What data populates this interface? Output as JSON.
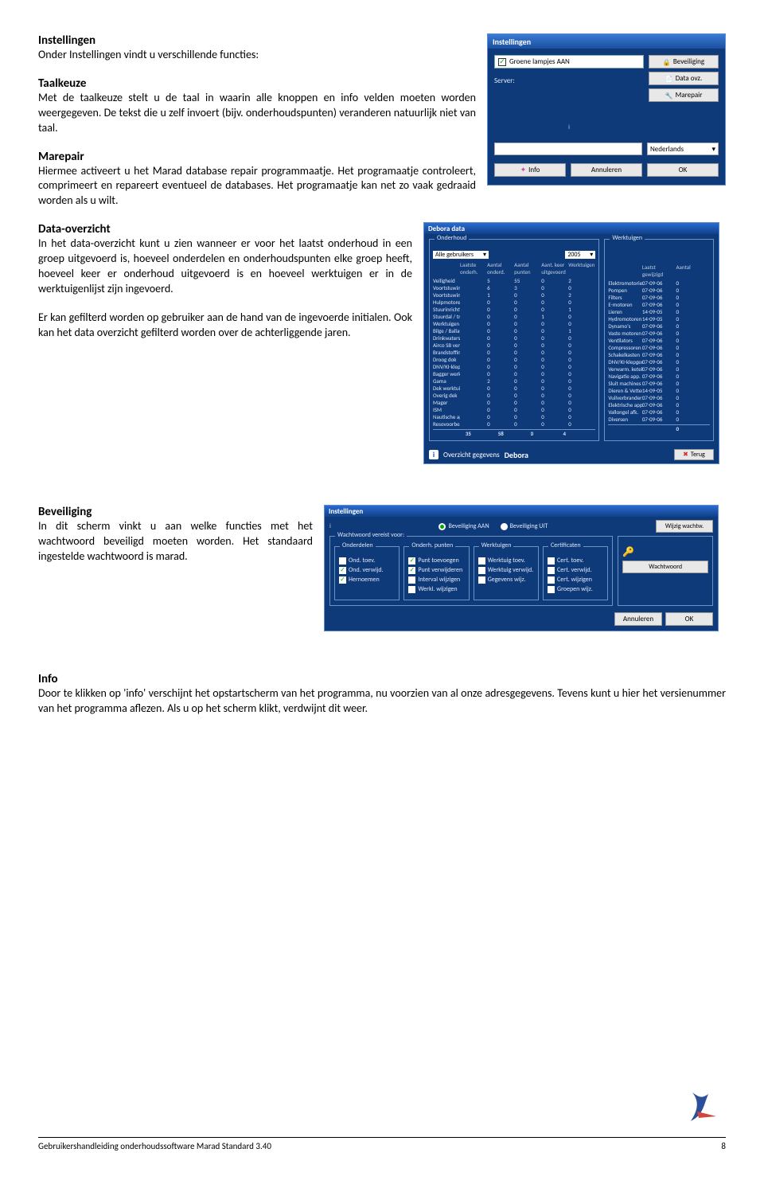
{
  "sections": {
    "instellingen_h": "Instellingen",
    "instellingen_sub": "Onder Instellingen vindt u verschillende functies:",
    "taalkeuze_h": "Taalkeuze",
    "taalkeuze_p": "Met de taalkeuze stelt u de taal in waarin alle knoppen en info velden moeten worden weergegeven. De tekst die u zelf invoert (bijv. onderhoudspunten) veranderen natuurlijk niet van taal.",
    "marepair_h": "Marepair",
    "marepair_p": "Hiermee activeert u het Marad database repair programmaatje. Het programaatje controleert, comprimeert en repareert eventueel de databases. Het programaatje kan net zo vaak gedraaid worden als u wilt.",
    "dataovz_h": "Data-overzicht",
    "dataovz_p1": "In het data-overzicht kunt u zien wanneer er voor het laatst onderhoud in een groep uitgevoerd is, hoeveel onderdelen en onderhoudspunten elke groep heeft, hoeveel keer er onderhoud uitgevoerd is en hoeveel werktuigen er in de werktuigenlijst zijn ingevoerd.",
    "dataovz_p2": "Er kan gefilterd worden op gebruiker aan de hand van de ingevoerde initialen. Ook kan het data overzicht gefilterd worden over de achterliggende jaren.",
    "beveiliging_h": "Beveiliging",
    "beveiliging_p": "In dit scherm vinkt u aan welke functies met het wachtwoord beveiligd moeten worden. Het standaard ingestelde wachtwoord is marad.",
    "info_h": "Info",
    "info_p": "Door te klikken op 'info' verschijnt het opstartscherm van het programma, nu voorzien van al onze adresgegevens. Tevens kunt u hier het versienummer van het programma aflezen. Als u op het scherm klikt, verdwijnt dit weer."
  },
  "win1": {
    "title": "Instellingen",
    "chk_green": "Groene lampjes AAN",
    "server": "Server:",
    "btn_bev": "Beveiliging",
    "btn_data": "Data ovz.",
    "btn_marepair": "Marepair",
    "lang": "Nederlands",
    "btn_info": "Info",
    "btn_cancel": "Annuleren",
    "btn_ok": "OK"
  },
  "win2": {
    "title": "Debora data",
    "grp1": "Onderhoud",
    "grp2": "Werktuigen",
    "filter_label": "Alle gebruikers",
    "year": "2005",
    "hdr1": [
      "",
      "Laatste onderh.",
      "Aantal onderd.",
      "Aantal punten",
      "Aant. keer uitgevoerd",
      "Werktuigen"
    ],
    "hdr2": [
      "",
      "Laatst gewijzigd",
      "Aantal"
    ],
    "rows1": [
      [
        "Veiligheid",
        "",
        "5",
        "55",
        "0",
        "2"
      ],
      [
        "Voortstuwing SB",
        "",
        "6",
        "3",
        "0",
        "0"
      ],
      [
        "Voortstuwing BB",
        "",
        "1",
        "0",
        "0",
        "2"
      ],
      [
        "Hulpmotoren",
        "",
        "0",
        "0",
        "0",
        "0"
      ],
      [
        "Stuurinrichting",
        "",
        "0",
        "0",
        "0",
        "1"
      ],
      [
        "Stuurdal / trim",
        "",
        "0",
        "0",
        "1",
        "0"
      ],
      [
        "Werktuigen",
        "",
        "0",
        "0",
        "0",
        "0"
      ],
      [
        "Bilge / Ballast",
        "",
        "0",
        "0",
        "0",
        "1"
      ],
      [
        "Drinkwatersyst.",
        "",
        "0",
        "0",
        "0",
        "0"
      ],
      [
        "Airco SB ventilasie",
        "",
        "0",
        "0",
        "0",
        "0"
      ],
      [
        "Brandstoffinst.",
        "",
        "0",
        "0",
        "0",
        "0"
      ],
      [
        "Droog dok",
        "",
        "0",
        "0",
        "0",
        "0"
      ],
      [
        "DNV/KI-klepgen",
        "",
        "0",
        "0",
        "0",
        "0"
      ],
      [
        "Bagger werktuigen",
        "",
        "0",
        "0",
        "0",
        "0"
      ],
      [
        "Gama",
        "",
        "2",
        "0",
        "0",
        "0"
      ],
      [
        "Dek werktuigen",
        "",
        "0",
        "0",
        "0",
        "0"
      ],
      [
        "Overig dek",
        "",
        "0",
        "0",
        "0",
        "0"
      ],
      [
        "Mager",
        "",
        "0",
        "0",
        "0",
        "0"
      ],
      [
        "ISM",
        "",
        "0",
        "0",
        "0",
        "0"
      ],
      [
        "Nautische app.",
        "",
        "0",
        "0",
        "0",
        "0"
      ],
      [
        "Resovoorbereid",
        "",
        "0",
        "0",
        "0",
        "0"
      ]
    ],
    "rows2": [
      [
        "Elektromotorieten",
        "07-09-06",
        "0"
      ],
      [
        "Pompen",
        "07-09-06",
        "0"
      ],
      [
        "Filters",
        "07-09-06",
        "0"
      ],
      [
        "E-motoren",
        "07-09-06",
        "0"
      ],
      [
        "Lieren",
        "14-09-05",
        "0"
      ],
      [
        "Hydromotoren",
        "14-09-05",
        "0"
      ],
      [
        "Dynamo's",
        "07-09-06",
        "0"
      ],
      [
        "Vaste motoren",
        "07-09-06",
        "0"
      ],
      [
        "Ventilators",
        "07-09-06",
        "0"
      ],
      [
        "Compressoren",
        "07-09-06",
        "0"
      ],
      [
        "Schakelkasten",
        "07-09-06",
        "0"
      ],
      [
        "DNV/KI-klepgen",
        "07-09-06",
        "0"
      ],
      [
        "Verwarm. ketels",
        "07-09-06",
        "0"
      ],
      [
        "Navigatie app.",
        "07-09-06",
        "0"
      ],
      [
        "Sluit machines",
        "07-09-06",
        "0"
      ],
      [
        "Dieren & Vetten",
        "14-09-05",
        "0"
      ],
      [
        "Vuilverbrander",
        "07-09-06",
        "0"
      ],
      [
        "Elektrische app.",
        "07-09-06",
        "0"
      ],
      [
        "Vallongel afk.",
        "07-09-06",
        "0"
      ],
      [
        "Diversen",
        "07-09-06",
        "0"
      ]
    ],
    "totals1": [
      "",
      "35",
      "58",
      "0",
      "4"
    ],
    "totals2": [
      "",
      "",
      "0"
    ],
    "overzicht": "Overzicht gegevens",
    "naam": "Debora",
    "btn_close": "Terug"
  },
  "win3": {
    "title": "Instellingen",
    "rad_on": "Beveiliging AAN",
    "rad_off": "Beveiliging UIT",
    "btn_wijzig": "Wijzig wachtw.",
    "grp_outer": "Wachtwoord vereist voor:",
    "g1": "Onderdelen",
    "g2": "Onderh. punten",
    "g3": "Werktuigen",
    "g4": "Certificaten",
    "c1": [
      "Ond. toev.",
      "Ond. verwijd.",
      "Hernoemen"
    ],
    "c2": [
      "Punt toevoegen",
      "Punt verwijderen",
      "Interval wijzigen",
      "Werkl. wijzigen"
    ],
    "c3": [
      "Werktuig toev.",
      "Werktuig verwijd.",
      "Gegevens wijz."
    ],
    "c4": [
      "Cert. toev.",
      "Cert. verwijd.",
      "Cert. wijzigen",
      "Groepen wijz."
    ],
    "pw_label": "Wachtwoord",
    "btn_cancel": "Annuleren",
    "btn_ok": "OK"
  },
  "footer": {
    "text": "Gebruikershandleiding onderhoudssoftware Marad Standard 3.40",
    "page": "8"
  }
}
